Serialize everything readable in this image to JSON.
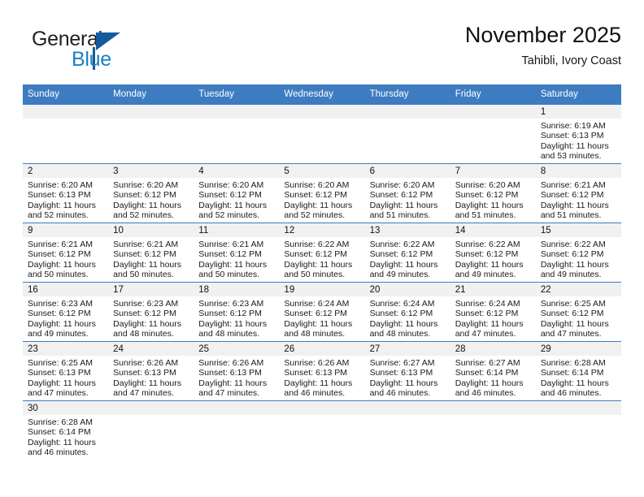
{
  "brand": {
    "name_part1": "General",
    "name_part2": "Blue",
    "logo_icon": "triangle-flag-icon"
  },
  "header": {
    "title": "November 2025",
    "subtitle": "Tahibli, Ivory Coast"
  },
  "colors": {
    "header_blue": "#3d7cc0",
    "brand_dark_blue": "#145a9e",
    "brand_light_blue": "#1c7fc3",
    "daynum_band": "#f1f1f1",
    "text": "#1a1a1a"
  },
  "calendar": {
    "weekdays": [
      "Sunday",
      "Monday",
      "Tuesday",
      "Wednesday",
      "Thursday",
      "Friday",
      "Saturday"
    ],
    "weeks": [
      [
        {
          "day": "",
          "lines": []
        },
        {
          "day": "",
          "lines": []
        },
        {
          "day": "",
          "lines": []
        },
        {
          "day": "",
          "lines": []
        },
        {
          "day": "",
          "lines": []
        },
        {
          "day": "",
          "lines": []
        },
        {
          "day": "1",
          "lines": [
            "Sunrise: 6:19 AM",
            "Sunset: 6:13 PM",
            "Daylight: 11 hours",
            "and 53 minutes."
          ]
        }
      ],
      [
        {
          "day": "2",
          "lines": [
            "Sunrise: 6:20 AM",
            "Sunset: 6:13 PM",
            "Daylight: 11 hours",
            "and 52 minutes."
          ]
        },
        {
          "day": "3",
          "lines": [
            "Sunrise: 6:20 AM",
            "Sunset: 6:12 PM",
            "Daylight: 11 hours",
            "and 52 minutes."
          ]
        },
        {
          "day": "4",
          "lines": [
            "Sunrise: 6:20 AM",
            "Sunset: 6:12 PM",
            "Daylight: 11 hours",
            "and 52 minutes."
          ]
        },
        {
          "day": "5",
          "lines": [
            "Sunrise: 6:20 AM",
            "Sunset: 6:12 PM",
            "Daylight: 11 hours",
            "and 52 minutes."
          ]
        },
        {
          "day": "6",
          "lines": [
            "Sunrise: 6:20 AM",
            "Sunset: 6:12 PM",
            "Daylight: 11 hours",
            "and 51 minutes."
          ]
        },
        {
          "day": "7",
          "lines": [
            "Sunrise: 6:20 AM",
            "Sunset: 6:12 PM",
            "Daylight: 11 hours",
            "and 51 minutes."
          ]
        },
        {
          "day": "8",
          "lines": [
            "Sunrise: 6:21 AM",
            "Sunset: 6:12 PM",
            "Daylight: 11 hours",
            "and 51 minutes."
          ]
        }
      ],
      [
        {
          "day": "9",
          "lines": [
            "Sunrise: 6:21 AM",
            "Sunset: 6:12 PM",
            "Daylight: 11 hours",
            "and 50 minutes."
          ]
        },
        {
          "day": "10",
          "lines": [
            "Sunrise: 6:21 AM",
            "Sunset: 6:12 PM",
            "Daylight: 11 hours",
            "and 50 minutes."
          ]
        },
        {
          "day": "11",
          "lines": [
            "Sunrise: 6:21 AM",
            "Sunset: 6:12 PM",
            "Daylight: 11 hours",
            "and 50 minutes."
          ]
        },
        {
          "day": "12",
          "lines": [
            "Sunrise: 6:22 AM",
            "Sunset: 6:12 PM",
            "Daylight: 11 hours",
            "and 50 minutes."
          ]
        },
        {
          "day": "13",
          "lines": [
            "Sunrise: 6:22 AM",
            "Sunset: 6:12 PM",
            "Daylight: 11 hours",
            "and 49 minutes."
          ]
        },
        {
          "day": "14",
          "lines": [
            "Sunrise: 6:22 AM",
            "Sunset: 6:12 PM",
            "Daylight: 11 hours",
            "and 49 minutes."
          ]
        },
        {
          "day": "15",
          "lines": [
            "Sunrise: 6:22 AM",
            "Sunset: 6:12 PM",
            "Daylight: 11 hours",
            "and 49 minutes."
          ]
        }
      ],
      [
        {
          "day": "16",
          "lines": [
            "Sunrise: 6:23 AM",
            "Sunset: 6:12 PM",
            "Daylight: 11 hours",
            "and 49 minutes."
          ]
        },
        {
          "day": "17",
          "lines": [
            "Sunrise: 6:23 AM",
            "Sunset: 6:12 PM",
            "Daylight: 11 hours",
            "and 48 minutes."
          ]
        },
        {
          "day": "18",
          "lines": [
            "Sunrise: 6:23 AM",
            "Sunset: 6:12 PM",
            "Daylight: 11 hours",
            "and 48 minutes."
          ]
        },
        {
          "day": "19",
          "lines": [
            "Sunrise: 6:24 AM",
            "Sunset: 6:12 PM",
            "Daylight: 11 hours",
            "and 48 minutes."
          ]
        },
        {
          "day": "20",
          "lines": [
            "Sunrise: 6:24 AM",
            "Sunset: 6:12 PM",
            "Daylight: 11 hours",
            "and 48 minutes."
          ]
        },
        {
          "day": "21",
          "lines": [
            "Sunrise: 6:24 AM",
            "Sunset: 6:12 PM",
            "Daylight: 11 hours",
            "and 47 minutes."
          ]
        },
        {
          "day": "22",
          "lines": [
            "Sunrise: 6:25 AM",
            "Sunset: 6:12 PM",
            "Daylight: 11 hours",
            "and 47 minutes."
          ]
        }
      ],
      [
        {
          "day": "23",
          "lines": [
            "Sunrise: 6:25 AM",
            "Sunset: 6:13 PM",
            "Daylight: 11 hours",
            "and 47 minutes."
          ]
        },
        {
          "day": "24",
          "lines": [
            "Sunrise: 6:26 AM",
            "Sunset: 6:13 PM",
            "Daylight: 11 hours",
            "and 47 minutes."
          ]
        },
        {
          "day": "25",
          "lines": [
            "Sunrise: 6:26 AM",
            "Sunset: 6:13 PM",
            "Daylight: 11 hours",
            "and 47 minutes."
          ]
        },
        {
          "day": "26",
          "lines": [
            "Sunrise: 6:26 AM",
            "Sunset: 6:13 PM",
            "Daylight: 11 hours",
            "and 46 minutes."
          ]
        },
        {
          "day": "27",
          "lines": [
            "Sunrise: 6:27 AM",
            "Sunset: 6:13 PM",
            "Daylight: 11 hours",
            "and 46 minutes."
          ]
        },
        {
          "day": "28",
          "lines": [
            "Sunrise: 6:27 AM",
            "Sunset: 6:14 PM",
            "Daylight: 11 hours",
            "and 46 minutes."
          ]
        },
        {
          "day": "29",
          "lines": [
            "Sunrise: 6:28 AM",
            "Sunset: 6:14 PM",
            "Daylight: 11 hours",
            "and 46 minutes."
          ]
        }
      ],
      [
        {
          "day": "30",
          "lines": [
            "Sunrise: 6:28 AM",
            "Sunset: 6:14 PM",
            "Daylight: 11 hours",
            "and 46 minutes."
          ]
        },
        {
          "day": "",
          "lines": []
        },
        {
          "day": "",
          "lines": []
        },
        {
          "day": "",
          "lines": []
        },
        {
          "day": "",
          "lines": []
        },
        {
          "day": "",
          "lines": []
        },
        {
          "day": "",
          "lines": []
        }
      ]
    ]
  }
}
